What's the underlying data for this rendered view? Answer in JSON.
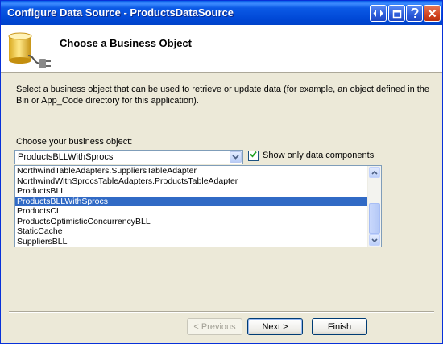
{
  "window": {
    "title": "Configure Data Source - ProductsDataSource"
  },
  "header": {
    "title": "Choose a Business Object"
  },
  "description": "Select a business object that can be used to retrieve or update data (for example, an object defined in the Bin or App_Code directory for this application).",
  "business_object": {
    "label": "Choose your business object:",
    "selected": "ProductsBLLWithSprocs",
    "show_only_data_components": {
      "label": "Show only data components",
      "checked": true
    }
  },
  "list": {
    "items": [
      {
        "label": "NorthwindTableAdapters.SuppliersTableAdapter"
      },
      {
        "label": "NorthwindWithSprocsTableAdapters.ProductsTableAdapter"
      },
      {
        "label": "ProductsBLL"
      },
      {
        "label": "ProductsBLLWithSprocs"
      },
      {
        "label": "ProductsCL"
      },
      {
        "label": "ProductsOptimisticConcurrencyBLL"
      },
      {
        "label": "StaticCache"
      },
      {
        "label": "SuppliersBLL"
      }
    ]
  },
  "buttons": {
    "previous": "< Previous",
    "next": "Next >",
    "finish": "Finish"
  },
  "colors": {
    "selection": "#316ac5",
    "titlebar": "#0054e3",
    "dialog": "#ece9d8"
  }
}
